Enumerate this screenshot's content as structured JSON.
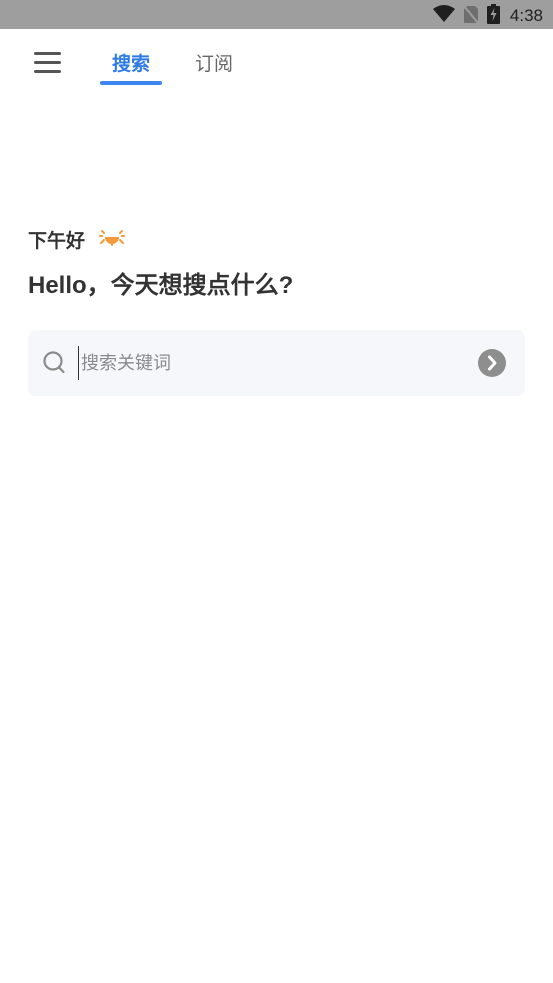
{
  "status_bar": {
    "time": "4:38",
    "icons": [
      "wifi-icon",
      "no-sim-icon",
      "battery-charging-icon"
    ]
  },
  "header": {
    "menu_icon": "hamburger-menu-icon",
    "tabs": [
      {
        "label": "搜索",
        "active": true
      },
      {
        "label": "订阅",
        "active": false
      }
    ],
    "accent_color": "#3d86ef"
  },
  "greeting": {
    "text": "下午好",
    "icon": "sun-icon",
    "icon_color": "#f39a3a"
  },
  "headline": "Hello，今天想搜点什么?",
  "search": {
    "value": "",
    "placeholder": "搜索关键词",
    "icon": "search-icon",
    "submit_icon": "chevron-right-circle-icon"
  }
}
